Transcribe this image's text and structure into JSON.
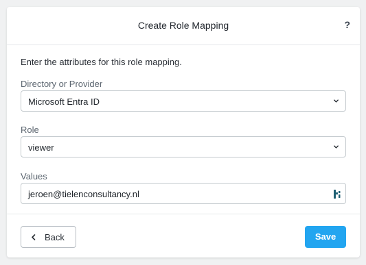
{
  "dialog": {
    "title": "Create Role Mapping",
    "help_label": "?",
    "intro": "Enter the attributes for this role mapping."
  },
  "fields": {
    "provider": {
      "label": "Directory or Provider",
      "value": "Microsoft Entra ID",
      "icon": "chevron-down-icon"
    },
    "role": {
      "label": "Role",
      "value": "viewer",
      "icon": "chevron-down-icon"
    },
    "values": {
      "label": "Values",
      "value": "jeroen@tielenconsultancy.nl",
      "icon": "password-manager-key-icon"
    }
  },
  "footer": {
    "back_label": "Back",
    "back_icon": "chevron-left-icon",
    "save_label": "Save"
  },
  "colors": {
    "accent": "#22a5f0",
    "border": "#c4cace",
    "label": "#5c6670",
    "background": "#f0f1f2"
  }
}
